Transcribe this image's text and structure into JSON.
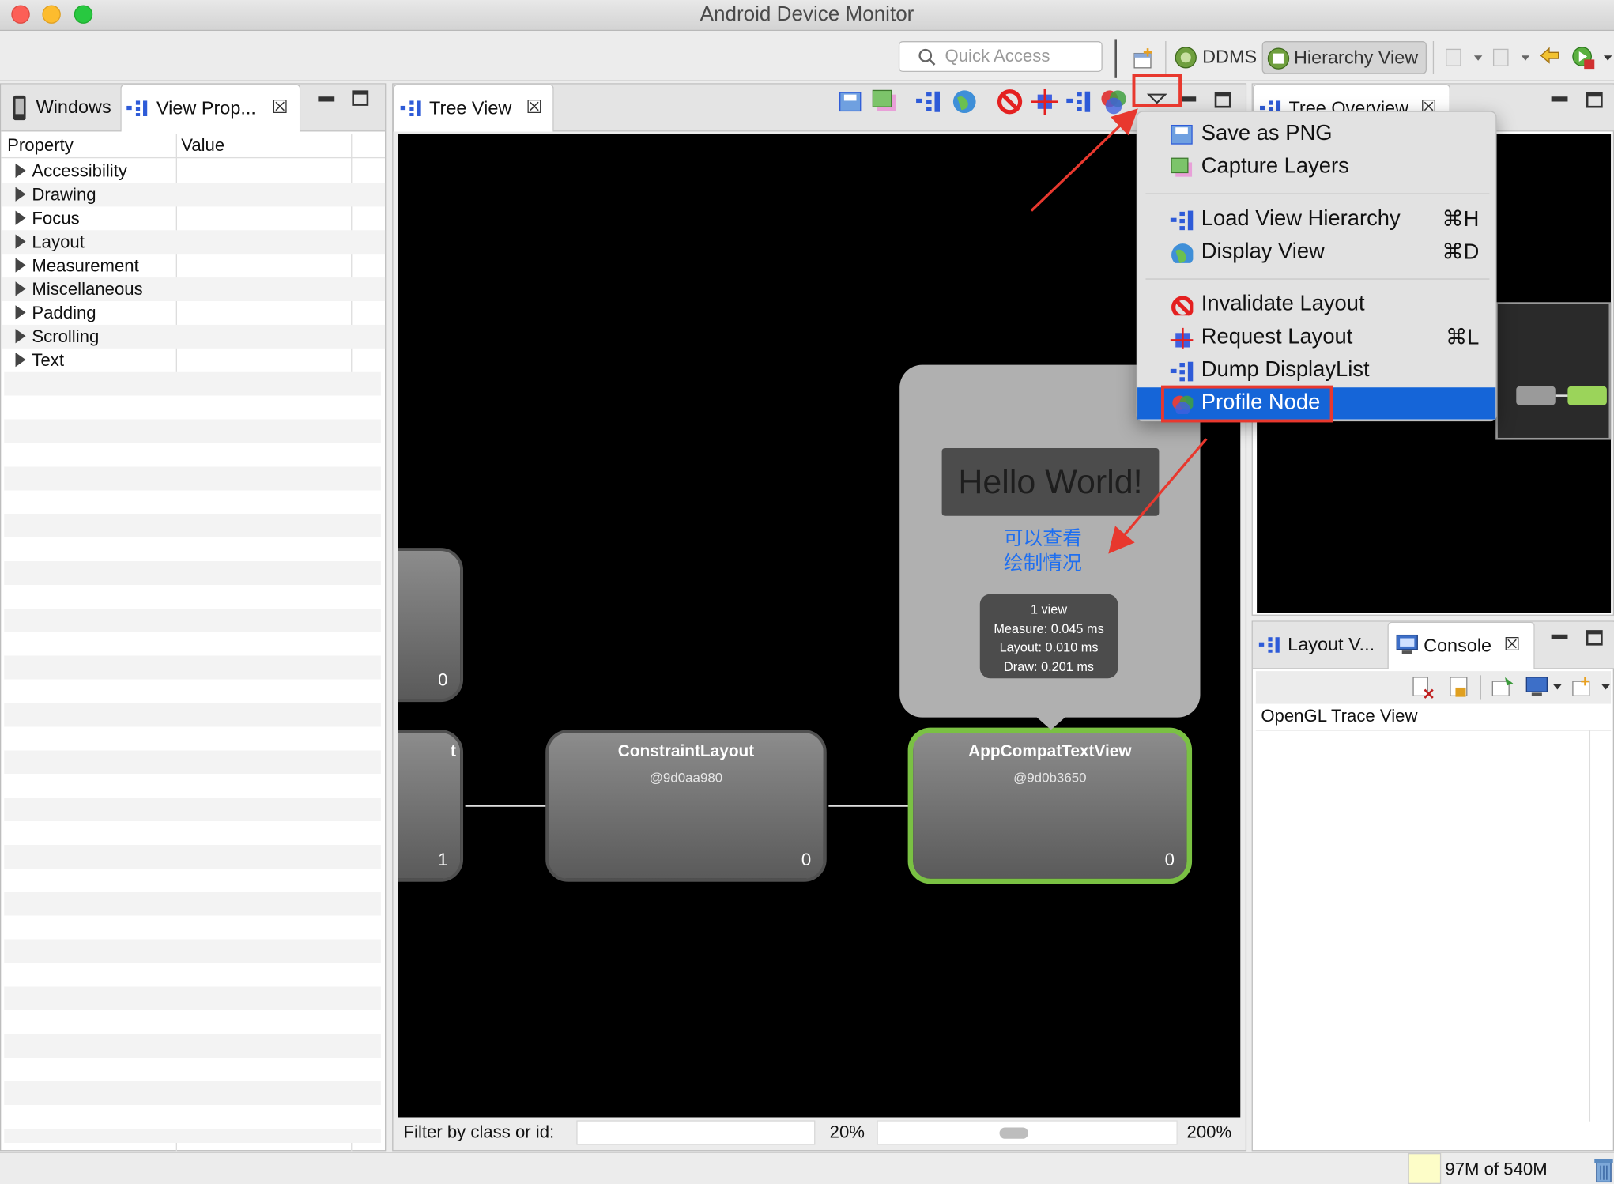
{
  "window": {
    "title": "Android Device Monitor"
  },
  "toolbar": {
    "quick_access_placeholder": "Quick Access",
    "perspectives": [
      {
        "label": "DDMS"
      },
      {
        "label": "Hierarchy View"
      }
    ]
  },
  "left_panel": {
    "tabs": [
      {
        "label": "Windows"
      },
      {
        "label": "View Prop..."
      }
    ],
    "columns": [
      "Property",
      "Value"
    ],
    "groups": [
      "Accessibility",
      "Drawing",
      "Focus",
      "Layout",
      "Measurement",
      "Miscellaneous",
      "Padding",
      "Scrolling",
      "Text"
    ]
  },
  "tree_view": {
    "tab_label": "Tree View",
    "nodes": [
      {
        "title": "",
        "id": "",
        "count": "0"
      },
      {
        "title": "t",
        "id": "",
        "count": "1"
      },
      {
        "title": "ConstraintLayout",
        "id": "@9d0aa980",
        "count": "0"
      },
      {
        "title": "AppCompatTextView",
        "id": "@9d0b3650",
        "count": "0"
      }
    ],
    "preview_text": "Hello World!",
    "annotation": [
      "可以查看",
      "绘制情况"
    ],
    "profile": {
      "views": "1 view",
      "measure": "Measure: 0.045 ms",
      "layout": "Layout: 0.010 ms",
      "draw": "Draw: 0.201 ms"
    },
    "filter_label": "Filter by class or id:",
    "filter_value": "",
    "zoom_min": "20%",
    "zoom_max": "200%",
    "zoom_level": 0.45
  },
  "menu": {
    "items": [
      {
        "label": "Save as PNG",
        "shortcut": ""
      },
      {
        "label": "Capture Layers",
        "shortcut": ""
      },
      {
        "label": "Load View Hierarchy",
        "shortcut": "⌘H"
      },
      {
        "label": "Display View",
        "shortcut": "⌘D"
      },
      {
        "label": "Invalidate Layout",
        "shortcut": ""
      },
      {
        "label": "Request Layout",
        "shortcut": "⌘L"
      },
      {
        "label": "Dump DisplayList",
        "shortcut": ""
      },
      {
        "label": "Profile Node",
        "shortcut": ""
      }
    ],
    "selected": "Profile Node"
  },
  "right_top": {
    "tab_label": "Tree Overview"
  },
  "right_bottom": {
    "tabs": [
      {
        "label": "Layout V..."
      },
      {
        "label": "Console"
      }
    ],
    "console_title": "OpenGL Trace View"
  },
  "status": {
    "memory": "97M of 540M"
  },
  "colors": {
    "accent": "#1565d8",
    "highlight": "#e8382e",
    "node_selected": "#7ac143",
    "canvas": "#000000"
  }
}
